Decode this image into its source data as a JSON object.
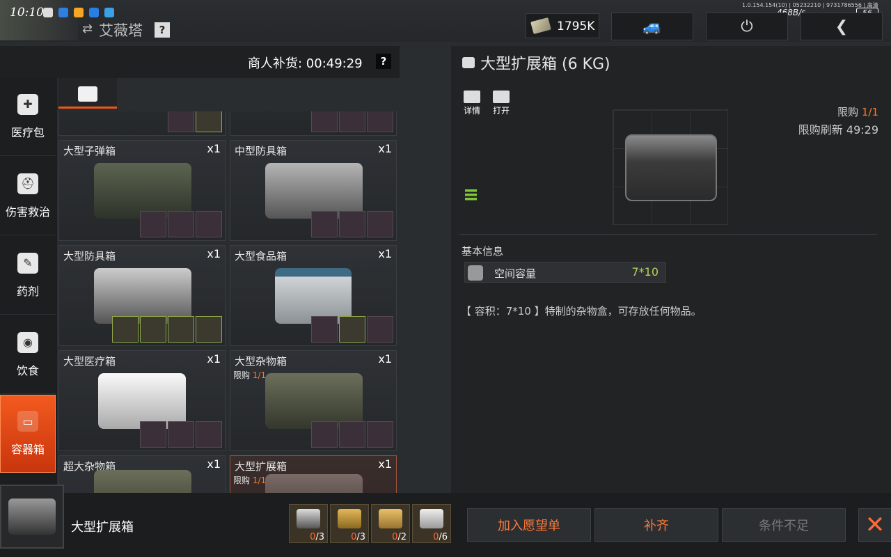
{
  "status": {
    "time": "10:10",
    "version": "1.0.154.154(10) | 05232210 | 9731786556 | 高清",
    "net": "468B/s",
    "battery": "56"
  },
  "player": {
    "name": "艾薇塔",
    "help": "?",
    "swap_icon": "⇄"
  },
  "money": {
    "value": "1795K"
  },
  "topbar": {
    "vehicle_icon": "🚙",
    "power_icon": "⏻",
    "back_icon": "❮"
  },
  "merchant": {
    "restock": "商人补货: 00:49:29",
    "help": "?"
  },
  "categories": [
    {
      "label": "医疗包",
      "icon": "✚"
    },
    {
      "label": "伤害救治",
      "icon": "⛑"
    },
    {
      "label": "药剂",
      "icon": "✎"
    },
    {
      "label": "饮食",
      "icon": "◉"
    },
    {
      "label": "容器箱",
      "icon": "▭"
    }
  ],
  "cards": [
    {
      "name": "",
      "qty": "",
      "limit": "",
      "limit_val": ""
    },
    {
      "name": "",
      "qty": "",
      "limit": "",
      "limit_val": ""
    },
    {
      "name": "大型子弹箱",
      "qty": "x1",
      "limit": "",
      "limit_val": ""
    },
    {
      "name": "中型防具箱",
      "qty": "x1",
      "limit": "",
      "limit_val": ""
    },
    {
      "name": "大型防具箱",
      "qty": "x1",
      "limit": "",
      "limit_val": ""
    },
    {
      "name": "大型食品箱",
      "qty": "x1",
      "limit": "",
      "limit_val": ""
    },
    {
      "name": "大型医疗箱",
      "qty": "x1",
      "limit": "",
      "limit_val": ""
    },
    {
      "name": "大型杂物箱",
      "qty": "x1",
      "limit": "限购 ",
      "limit_val": "1/1"
    },
    {
      "name": "超大杂物箱",
      "qty": "x1",
      "limit": "",
      "limit_val": ""
    },
    {
      "name": "大型扩展箱",
      "qty": "x1",
      "limit": "限购 ",
      "limit_val": "1/1"
    }
  ],
  "detail": {
    "title": "大型扩展箱 (6 KG)",
    "btn_detail": "详情",
    "btn_open": "打开",
    "limit_label": "限购 ",
    "limit_val": "1/1",
    "limit_refresh": "限购刷新 49:29",
    "info_label": "基本信息",
    "info_key": "空间容量",
    "info_val": "7*10",
    "desc": "【 容积：7*10 】特制的杂物盒，可存放任何物品。"
  },
  "bottom": {
    "selected_name": "大型扩展箱",
    "materials": [
      {
        "have": "0",
        "need": "/3"
      },
      {
        "have": "0",
        "need": "/3"
      },
      {
        "have": "0",
        "need": "/2"
      },
      {
        "have": "0",
        "need": "/6"
      }
    ],
    "wishlist": "加入愿望单",
    "refill": "补齐",
    "insufficient": "条件不足",
    "close_icon": "✕"
  },
  "colors": {
    "accent": "#f0561c",
    "limit": "#ff7a2a",
    "value_green": "#b6d15a"
  }
}
